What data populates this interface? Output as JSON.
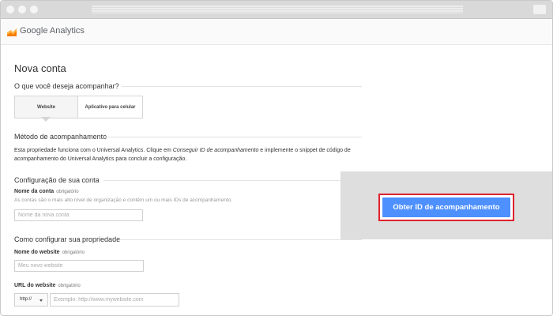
{
  "app": {
    "brand": "Google Analytics"
  },
  "page": {
    "title": "Nova conta"
  },
  "tracking": {
    "question": "O que você deseja acompanhar?",
    "options": [
      "Website",
      "Aplicativo para celular"
    ]
  },
  "method": {
    "title": "Método de acompanhamento",
    "text_a": "Esta propriedade funciona com o Universal Analytics.  Clique em ",
    "text_link": "Conseguir ID de acompanhamento",
    "text_b": " e implemente o snippet de código de acompanhamento do Universal Analytics para concluir a configuração."
  },
  "account": {
    "section_title": "Configuração de sua conta",
    "name_label": "Nome da conta",
    "required": "obrigatório",
    "hint": "As contas são o mais alto nível de organização e contêm um ou mais IDs de acompanhamento.",
    "name_placeholder": "Nome da nova conta"
  },
  "property": {
    "section_title": "Como configurar sua propriedade",
    "site_label": "Nome do website",
    "required": "obrigatório",
    "site_placeholder": "Meu novo website",
    "url_label": "URL do website",
    "url_required": "obrigatório",
    "protocol": "http://",
    "url_placeholder": "Exemplo: http://www.mywebsite.com"
  },
  "cta": {
    "label": "Obter ID de acompanhamento",
    "highlight_color": "#e0212f",
    "button_color": "#4d90fe"
  }
}
